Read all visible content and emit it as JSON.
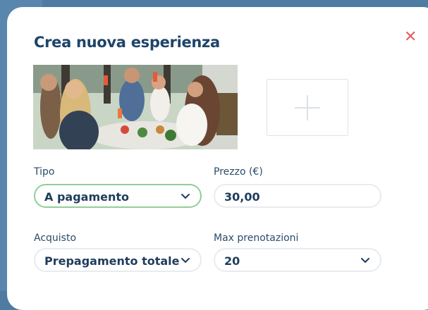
{
  "modal": {
    "title": "Crea nuova esperienza",
    "close_icon": "close-icon",
    "photo_alt": "",
    "add_photo_icon": "plus-icon"
  },
  "form": {
    "tipo": {
      "label": "Tipo",
      "value": "A pagamento",
      "icon": "chevron-down-icon"
    },
    "prezzo": {
      "label": "Prezzo (€)",
      "value": "30,00"
    },
    "acquisto": {
      "label": "Acquisto",
      "value": "Prepagamento totale",
      "icon": "chevron-down-icon"
    },
    "max": {
      "label": "Max prenotazioni",
      "value": "20",
      "icon": "chevron-down-icon"
    }
  },
  "colors": {
    "title": "#1f4469",
    "close": "#e0605f",
    "focus_border": "#8fcf97",
    "backdrop": "#4d7ba2"
  }
}
